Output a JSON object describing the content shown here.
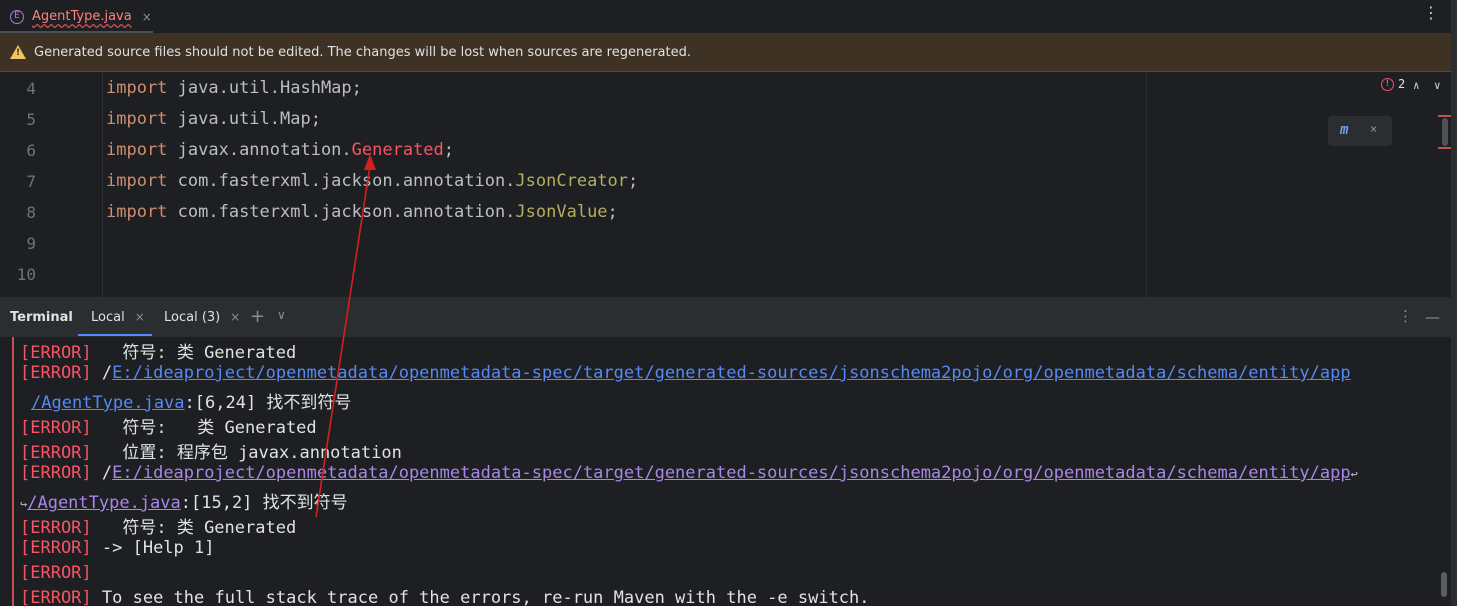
{
  "tab": {
    "icon_letter": "E",
    "label": "AgentType.java",
    "close": "×"
  },
  "menu_kebab": "⋮",
  "banner": {
    "text": "Generated source files should not be edited. The changes will be lost when sources are regenerated."
  },
  "editor": {
    "lines": [
      {
        "num": "4"
      },
      {
        "num": "5"
      },
      {
        "num": "6"
      },
      {
        "num": "7"
      },
      {
        "num": "8"
      },
      {
        "num": "9"
      },
      {
        "num": "10"
      }
    ],
    "code": {
      "l4": {
        "kw": "import",
        "rest": " java.util.HashMap;"
      },
      "l5": {
        "kw": "import",
        "rest": " java.util.Map;"
      },
      "l6": {
        "kw": "import",
        "pre": " javax.annotation.",
        "err": "Generated",
        "post": ";"
      },
      "l7": {
        "kw": "import",
        "pre": " com.fasterxml.jackson.annotation.",
        "anno": "JsonCreator",
        "post": ";"
      },
      "l8": {
        "kw": "import",
        "pre": " com.fasterxml.jackson.annotation.",
        "anno": "JsonValue",
        "post": ";"
      }
    },
    "error_count": "2",
    "nav_up": "∧",
    "nav_down": "∨",
    "maven_close": "×"
  },
  "terminal": {
    "title": "Terminal",
    "tabs": [
      {
        "label": "Local",
        "close": "×"
      },
      {
        "label": "Local (3)",
        "close": "×"
      }
    ],
    "plus": "+",
    "chevron": "∨",
    "kebab": "⋮",
    "minimize": "—",
    "lines": {
      "t1": {
        "tag": "[ERROR]",
        "text": "   符号: 类 Generated"
      },
      "t2": {
        "tag": "[ERROR]",
        "pre": " /",
        "link": "E:/ideaproject/openmetadata/openmetadata-spec/target/generated-sources/jsonschema2pojo/org/openmetadata/schema/entity/app"
      },
      "t3": {
        "link": "/AgentType.java",
        "text": ":[6,24] 找不到符号"
      },
      "t4": {
        "tag": "[ERROR]",
        "text": "   符号:   类 Generated"
      },
      "t5": {
        "tag": "[ERROR]",
        "text": "   位置: 程序包 javax.annotation"
      },
      "t6": {
        "tag": "[ERROR]",
        "pre": " /",
        "link": "E:/ideaproject/openmetadata/openmetadata-spec/target/generated-sources/jsonschema2pojo/org/openmetadata/schema/entity/app",
        "wrap": "↩"
      },
      "t7": {
        "wrap": "↪",
        "link": "/AgentType.java",
        "text": ":[15,2] 找不到符号"
      },
      "t8": {
        "tag": "[ERROR]",
        "text": "   符号: 类 Generated"
      },
      "t9": {
        "tag": "[ERROR]",
        "text": " -> [Help 1]"
      },
      "t10": {
        "tag": "[ERROR]",
        "text": ""
      },
      "t11": {
        "tag": "[ERROR]",
        "text": " To see the full stack trace of the errors, re-run Maven with the -e switch."
      }
    }
  },
  "colors": {
    "error": "#f75464",
    "keyword": "#cf8e6d",
    "annotation": "#b3ae60",
    "link": "#548af7",
    "arrow": "#d42020"
  }
}
